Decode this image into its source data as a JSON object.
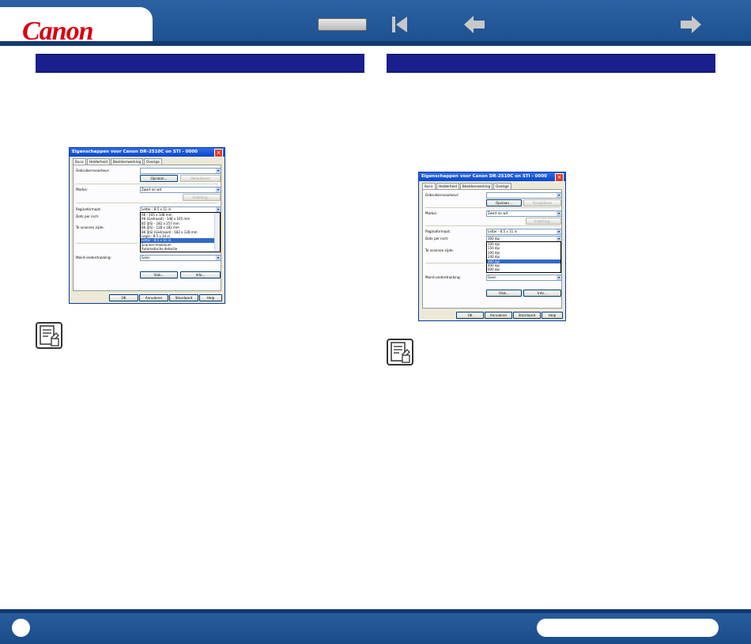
{
  "header": {
    "logo_text": "Canon",
    "colors": {
      "bar": "#1c4f8e",
      "logo": "#d90011"
    }
  },
  "nav": {
    "home_icon": "home-button-icon",
    "first_icon": "skip-to-first-icon",
    "prev_icon": "arrow-left-icon",
    "next_icon": "arrow-right-icon"
  },
  "left_dialog": {
    "title": "Eigenschappen voor Canon DR-2510C on STI - 0000",
    "tabs": [
      "Basic",
      "Helderheid",
      "Beeldverwerking",
      "Overige"
    ],
    "labels": {
      "user_pref": "Gebruikersvoorkeur:",
      "mode": "Modus:",
      "page_size": "Paginaformaat:",
      "dpi": "Dots per inch:",
      "scan_side": "Te scannen zijde:",
      "moire": "Moiré-onderdrukking:"
    },
    "values": {
      "user_pref": "",
      "mode": "Zwart en wit",
      "page_size": "Letter - 8.5 x 11 in",
      "moire": "Geen"
    },
    "buttons": {
      "save": "Opslaan...",
      "delete": "Verwijderen",
      "settings": "Instelling...",
      "area": "Vlak...",
      "info": "Info...",
      "ok": "OK",
      "cancel": "Annuleren",
      "default": "Standaard",
      "help": "Help"
    },
    "dropdown_items": [
      "A6 - 105 x 148 mm",
      "A6 (Gedraaid) - 148 x 105 mm",
      "B5 (JIS) - 182 x 257 mm",
      "B6 (JIS) - 128 x 182 mm",
      "B6 (JIS) (Gedraaid) - 182 x 128 mm",
      "Legal - 8.5 x 14 in",
      "Letter - 8.5 x 11 in",
      "Scanner-maximum",
      "Automatische detectie"
    ],
    "dropdown_selected_index": 6
  },
  "right_dialog": {
    "title": "Eigenschappen voor Canon DR-2510C on STI - 0000",
    "tabs": [
      "Basic",
      "Helderheid",
      "Beeldverwerking",
      "Overige"
    ],
    "labels": {
      "user_pref": "Gebruikersvoorkeur:",
      "mode": "Modus:",
      "page_size": "Paginaformaat:",
      "dpi": "Dots per inch:",
      "scan_side": "Te scannen zijde:",
      "moire": "Moiré-onderdrukking:"
    },
    "values": {
      "user_pref": "",
      "mode": "Zwart en wit",
      "page_size": "Letter - 8.5 x 11 in",
      "dpi": "300 dpi",
      "moire": "Geen"
    },
    "buttons": {
      "save": "Opslaan...",
      "delete": "Verwijderen",
      "settings": "Instelling...",
      "area": "Vlak...",
      "info": "Info...",
      "ok": "OK",
      "cancel": "Annuleren",
      "default": "Standaard",
      "help": "Help"
    },
    "dropdown_items": [
      "100 dpi",
      "150 dpi",
      "200 dpi",
      "240 dpi",
      "300 dpi",
      "400 dpi",
      "600 dpi"
    ],
    "dropdown_selected_index": 4
  },
  "memo_icon": "memo-note-icon",
  "footer": {
    "page_number": "",
    "pill_text": ""
  }
}
